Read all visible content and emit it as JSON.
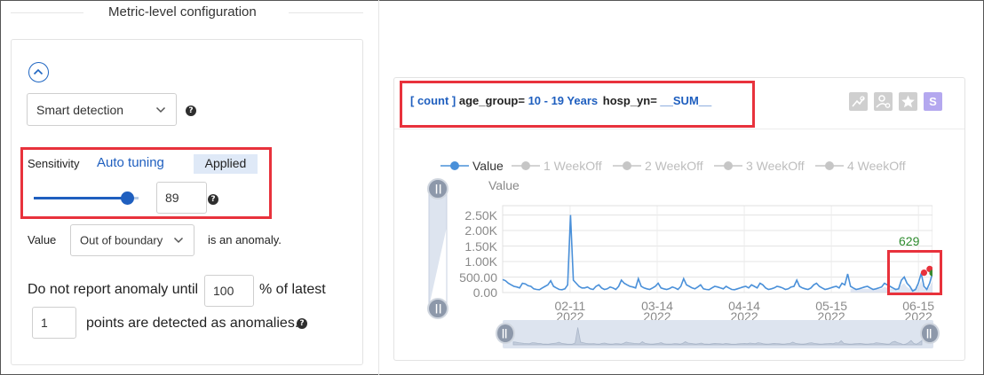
{
  "config": {
    "section_title": "Metric-level configuration",
    "detection_method": "Smart detection",
    "sensitivity": {
      "label": "Sensitivity",
      "auto_tuning_label": "Auto tuning",
      "status": "Applied",
      "value": "89",
      "slider_fraction": 0.89
    },
    "anomaly_rule": {
      "prefix": "Value",
      "selected": "Out of boundary",
      "suffix": "is an anomaly."
    },
    "report_rule": {
      "prefix": "Do not report anomaly until",
      "percent": "100",
      "middle": "% of latest",
      "points": "1",
      "suffix": "points are detected as anomalies."
    },
    "help_glyph": "?"
  },
  "series_header": {
    "measure": "[ count ]",
    "dim1_key": "age_group=",
    "dim1_val": "10 - 19 Years",
    "dim2_key": "hosp_yn=",
    "dim2_val": "__SUM__"
  },
  "toolbar": {
    "icons": [
      "compare-icon",
      "user-settings-icon",
      "star-icon",
      "s-icon"
    ],
    "s_label": "S"
  },
  "chart_data": {
    "type": "line",
    "legend": [
      "Value",
      "1 WeekOff",
      "2 WeekOff",
      "3 WeekOff",
      "4 WeekOff"
    ],
    "ylabel": "Value",
    "yticks": [
      "0.00",
      "500.00",
      "1.00K",
      "1.50K",
      "2.00K",
      "2.50K"
    ],
    "ylim": [
      0,
      2800
    ],
    "xticks": [
      {
        "label": "02-11",
        "year": "2022"
      },
      {
        "label": "03-14",
        "year": "2022"
      },
      {
        "label": "04-14",
        "year": "2022"
      },
      {
        "label": "05-15",
        "year": "2022"
      },
      {
        "label": "06-15",
        "year": "2022"
      }
    ],
    "x_range": [
      "2022-01-18",
      "2022-06-20"
    ],
    "annotation": "629",
    "series": [
      {
        "name": "Value",
        "color": "#4a90d9",
        "values": [
          420,
          380,
          300,
          250,
          200,
          180,
          150,
          300,
          280,
          220,
          200,
          120,
          100,
          90,
          150,
          200,
          250,
          380,
          200,
          150,
          100,
          90,
          120,
          250,
          2500,
          400,
          300,
          200,
          150,
          150,
          180,
          120,
          100,
          200,
          250,
          150,
          100,
          120,
          180,
          150,
          100,
          200,
          400,
          300,
          250,
          200,
          180,
          150,
          450,
          200,
          150,
          120,
          100,
          150,
          200,
          300,
          150,
          120,
          100,
          130,
          180,
          150,
          100,
          200,
          450,
          250,
          200,
          150,
          120,
          180,
          250,
          120,
          100,
          90,
          150,
          200,
          180,
          150,
          120,
          200,
          150,
          100,
          90,
          120,
          150,
          180,
          200,
          150,
          250,
          200,
          150,
          300,
          250,
          150,
          100,
          120,
          150,
          200,
          180,
          150,
          100,
          120,
          180,
          200,
          400,
          200,
          150,
          120,
          100,
          150,
          250,
          300,
          200,
          150,
          100,
          120,
          150,
          180,
          200,
          150,
          300,
          250,
          600,
          200,
          150,
          100,
          120,
          150,
          180,
          200,
          150,
          100,
          120,
          150,
          180,
          300,
          250,
          200,
          150,
          100,
          120,
          400,
          500,
          300,
          200,
          50,
          100,
          300,
          620,
          200,
          100,
          300,
          629
        ]
      }
    ],
    "anomaly_points": [
      {
        "index": 149,
        "value": 640,
        "color": "#e8323c"
      },
      {
        "index": 151,
        "value": 760,
        "color": "#e8323c"
      },
      {
        "index": 152,
        "value": 629,
        "color": "#3a8a2e"
      }
    ],
    "colors": {
      "value_line": "#4a90d9",
      "weekoff": "#c6c6c6",
      "anomaly": "#e8323c",
      "annotation_text": "#2e8b2e",
      "band": "#c9d3ea"
    }
  },
  "colors": {
    "accent": "#1f5fbf",
    "highlight_box": "#e8323c",
    "applied_bg": "#dfe9f7"
  }
}
